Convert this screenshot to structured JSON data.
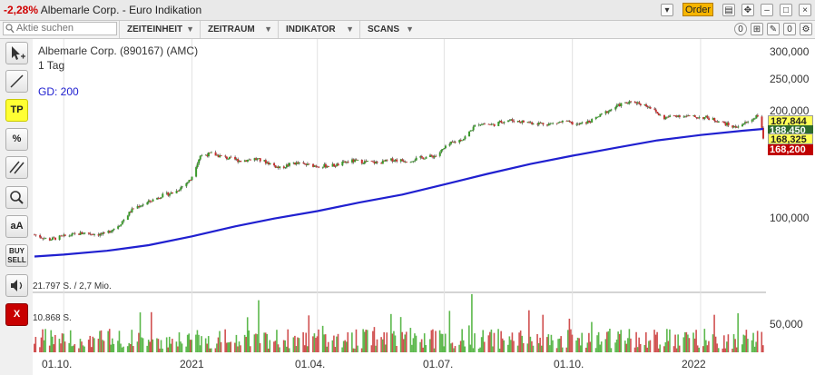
{
  "window": {
    "change": "-2,28%",
    "title": "Albemarle Corp. - Euro Indikation",
    "order_label": "Order"
  },
  "toolbar": {
    "search_placeholder": "Aktie suchen",
    "menus": [
      "ZEITEINHEIT",
      "ZEITRAUM",
      "INDIKATOR",
      "SCANS"
    ],
    "badges": [
      "0",
      "0"
    ]
  },
  "tools": {
    "tp": "TP",
    "percent": "%",
    "aa": "aA",
    "buy": "BUY",
    "sell": "SELL",
    "close": "X"
  },
  "chart_data": {
    "type": "candlestick",
    "title": "Albemarle Corp. (890167) (AMC)",
    "interval": "1 Tag",
    "indicator_label": "GD: 200",
    "y_ticks": [
      "300,000",
      "250,000",
      "200,000",
      "100,000"
    ],
    "x_ticks": [
      "01.10.",
      "2021",
      "01.04.",
      "01.07.",
      "01.10.",
      "2022"
    ],
    "volume_label": "21.797 S. / 2,7 Mio.",
    "volume_scale_label": "10.868 S.",
    "volume_tick": "50,000",
    "last_prices": [
      "187,844",
      "188,450",
      "168,325",
      "168,200"
    ],
    "close_series": [
      {
        "d": "2020-09-10",
        "c": 89
      },
      {
        "d": "2020-09-20",
        "c": 86
      },
      {
        "d": "2020-10-01",
        "c": 88
      },
      {
        "d": "2020-10-15",
        "c": 90
      },
      {
        "d": "2020-10-30",
        "c": 89
      },
      {
        "d": "2020-11-10",
        "c": 95
      },
      {
        "d": "2020-11-20",
        "c": 106
      },
      {
        "d": "2020-11-30",
        "c": 110
      },
      {
        "d": "2020-12-10",
        "c": 115
      },
      {
        "d": "2020-12-20",
        "c": 118
      },
      {
        "d": "2020-12-31",
        "c": 128
      },
      {
        "d": "2021-01-07",
        "c": 150
      },
      {
        "d": "2021-01-15",
        "c": 152
      },
      {
        "d": "2021-01-25",
        "c": 148
      },
      {
        "d": "2021-02-05",
        "c": 145
      },
      {
        "d": "2021-02-15",
        "c": 147
      },
      {
        "d": "2021-02-25",
        "c": 143
      },
      {
        "d": "2021-03-05",
        "c": 138
      },
      {
        "d": "2021-03-15",
        "c": 143
      },
      {
        "d": "2021-03-25",
        "c": 141
      },
      {
        "d": "2021-04-05",
        "c": 140
      },
      {
        "d": "2021-04-15",
        "c": 141
      },
      {
        "d": "2021-04-25",
        "c": 145
      },
      {
        "d": "2021-05-05",
        "c": 144
      },
      {
        "d": "2021-05-15",
        "c": 143
      },
      {
        "d": "2021-05-25",
        "c": 146
      },
      {
        "d": "2021-06-05",
        "c": 145
      },
      {
        "d": "2021-06-15",
        "c": 148
      },
      {
        "d": "2021-06-25",
        "c": 150
      },
      {
        "d": "2021-07-05",
        "c": 162
      },
      {
        "d": "2021-07-15",
        "c": 168
      },
      {
        "d": "2021-07-25",
        "c": 186
      },
      {
        "d": "2021-08-05",
        "c": 184
      },
      {
        "d": "2021-08-15",
        "c": 190
      },
      {
        "d": "2021-08-25",
        "c": 188
      },
      {
        "d": "2021-09-05",
        "c": 186
      },
      {
        "d": "2021-09-15",
        "c": 185
      },
      {
        "d": "2021-09-25",
        "c": 188
      },
      {
        "d": "2021-10-05",
        "c": 184
      },
      {
        "d": "2021-10-15",
        "c": 189
      },
      {
        "d": "2021-10-25",
        "c": 200
      },
      {
        "d": "2021-11-05",
        "c": 211
      },
      {
        "d": "2021-11-15",
        "c": 214
      },
      {
        "d": "2021-11-25",
        "c": 208
      },
      {
        "d": "2021-12-05",
        "c": 192
      },
      {
        "d": "2021-12-15",
        "c": 196
      },
      {
        "d": "2021-12-25",
        "c": 194
      },
      {
        "d": "2022-01-05",
        "c": 193
      },
      {
        "d": "2022-01-15",
        "c": 188
      },
      {
        "d": "2022-01-25",
        "c": 181
      },
      {
        "d": "2022-02-05",
        "c": 188
      },
      {
        "d": "2022-02-12",
        "c": 198
      },
      {
        "d": "2022-02-15",
        "c": 168
      }
    ],
    "sma200_series": [
      {
        "d": "2020-09-10",
        "c": 77
      },
      {
        "d": "2020-10-01",
        "c": 78
      },
      {
        "d": "2020-11-01",
        "c": 80
      },
      {
        "d": "2020-12-01",
        "c": 83
      },
      {
        "d": "2021-01-01",
        "c": 88
      },
      {
        "d": "2021-02-01",
        "c": 94
      },
      {
        "d": "2021-03-01",
        "c": 99
      },
      {
        "d": "2021-04-01",
        "c": 104
      },
      {
        "d": "2021-05-01",
        "c": 110
      },
      {
        "d": "2021-06-01",
        "c": 116
      },
      {
        "d": "2021-07-01",
        "c": 124
      },
      {
        "d": "2021-08-01",
        "c": 133
      },
      {
        "d": "2021-09-01",
        "c": 142
      },
      {
        "d": "2021-10-01",
        "c": 150
      },
      {
        "d": "2021-11-01",
        "c": 158
      },
      {
        "d": "2021-12-01",
        "c": 166
      },
      {
        "d": "2022-01-01",
        "c": 172
      },
      {
        "d": "2022-02-01",
        "c": 177
      },
      {
        "d": "2022-02-15",
        "c": 179
      }
    ]
  },
  "colors": {
    "up": "#3a9a2a",
    "down": "#c83030",
    "sma": "#2020d0",
    "volume_up": "#5cb84c",
    "volume_down": "#d05050"
  }
}
